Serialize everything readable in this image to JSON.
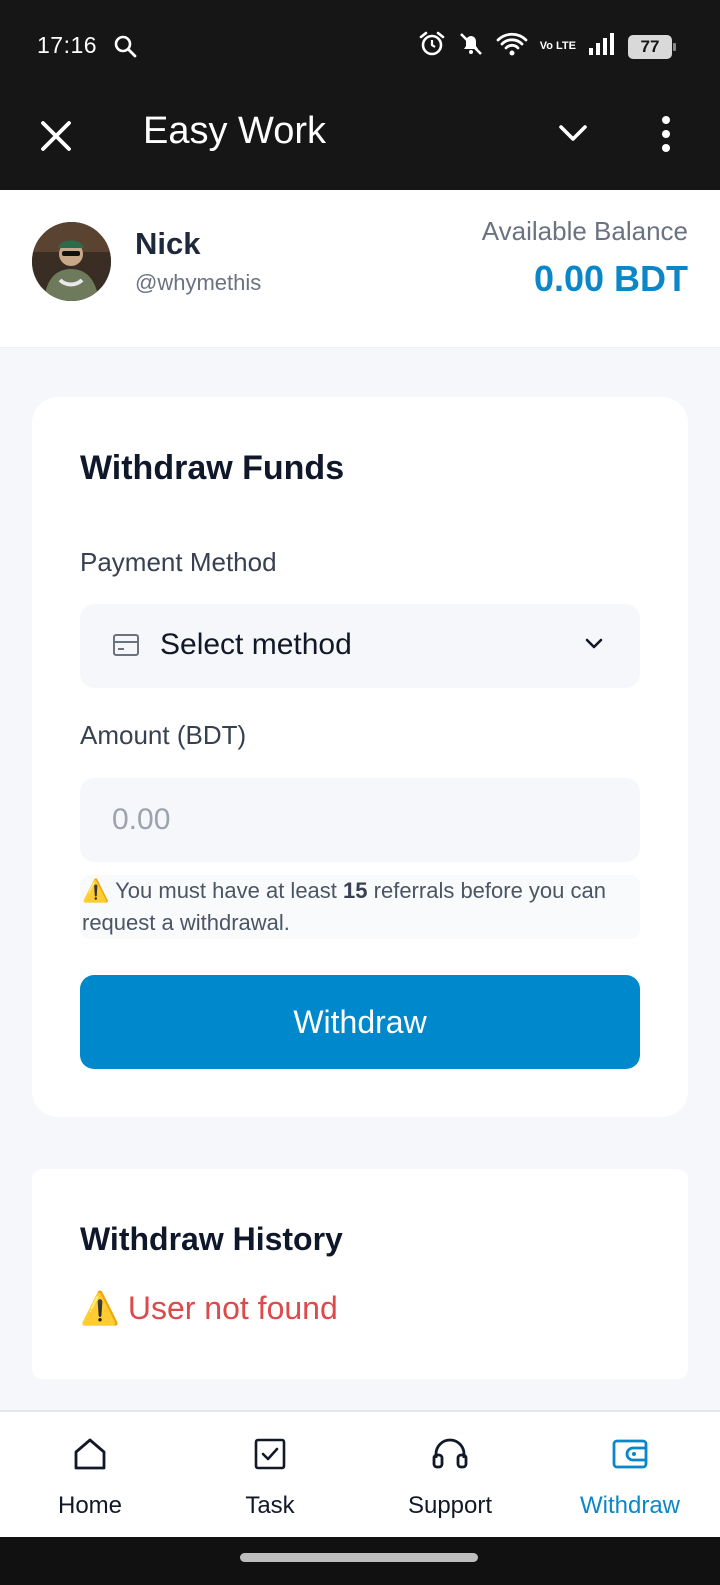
{
  "status_bar": {
    "time": "17:16",
    "network": "Vo LTE",
    "battery": "77"
  },
  "app_bar": {
    "title": "Easy Work"
  },
  "profile": {
    "name": "Nick",
    "handle": "@whymethis",
    "balance_label": "Available Balance",
    "balance_value": "0.00 BDT"
  },
  "withdraw_card": {
    "title": "Withdraw Funds",
    "payment_method_label": "Payment Method",
    "payment_method_value": "Select method",
    "amount_label": "Amount (BDT)",
    "amount_placeholder": "0.00",
    "notice_icon": "⚠️",
    "notice_before": "You must have at least",
    "notice_count": "15",
    "notice_after": "referrals before you can request a withdrawal.",
    "button_label": "Withdraw"
  },
  "history": {
    "title": "Withdraw History",
    "error_icon": "⚠️",
    "error_text": "User not found"
  },
  "bottom_nav": {
    "items": [
      {
        "label": "Home",
        "icon": "home-icon"
      },
      {
        "label": "Task",
        "icon": "task-icon"
      },
      {
        "label": "Support",
        "icon": "headset-icon"
      },
      {
        "label": "Withdraw",
        "icon": "wallet-icon",
        "active": true
      }
    ]
  },
  "colors": {
    "accent": "#0088cc",
    "balance": "#0a87c9",
    "error": "#dc4a4a",
    "bar": "#161616"
  }
}
